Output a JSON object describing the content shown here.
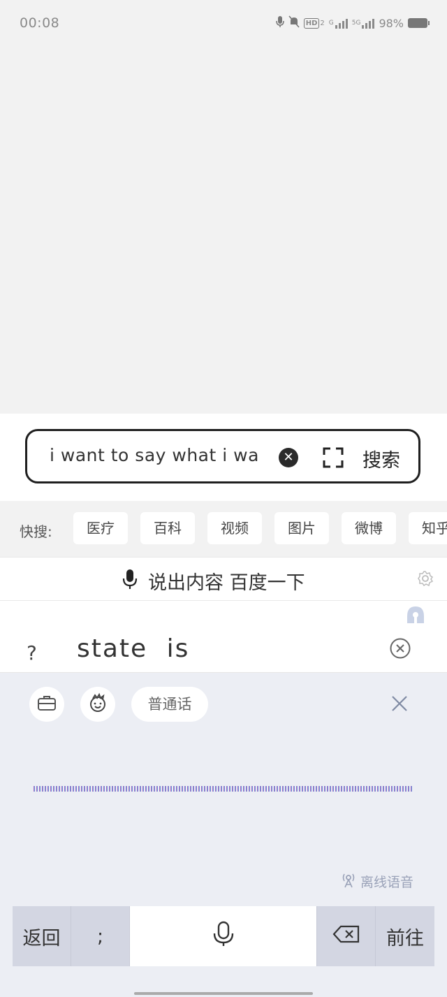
{
  "status_bar": {
    "time": "00:08",
    "hd_label": "HD",
    "hd_sub": "2",
    "net1": "G",
    "net2": "5G",
    "battery": "98%"
  },
  "search": {
    "query": "i want to say what i wa",
    "button_label": "搜索"
  },
  "quick_search": {
    "label": "快搜:",
    "items": [
      "医疗",
      "百科",
      "视频",
      "图片",
      "微博",
      "知乎"
    ]
  },
  "voice_bar": {
    "label": "说出内容 百度一下"
  },
  "recognition": {
    "prefix": "?",
    "text": "state is"
  },
  "voice_panel": {
    "language_label": "普通话",
    "offline_label": "离线语音"
  },
  "keyboard": {
    "back_label": "返回",
    "semicolon_label": ";",
    "go_label": "前往"
  },
  "colors": {
    "wave_start": "#c05ab5",
    "wave_mid": "#8a7ad0",
    "wave_end": "#4fb3e0"
  }
}
